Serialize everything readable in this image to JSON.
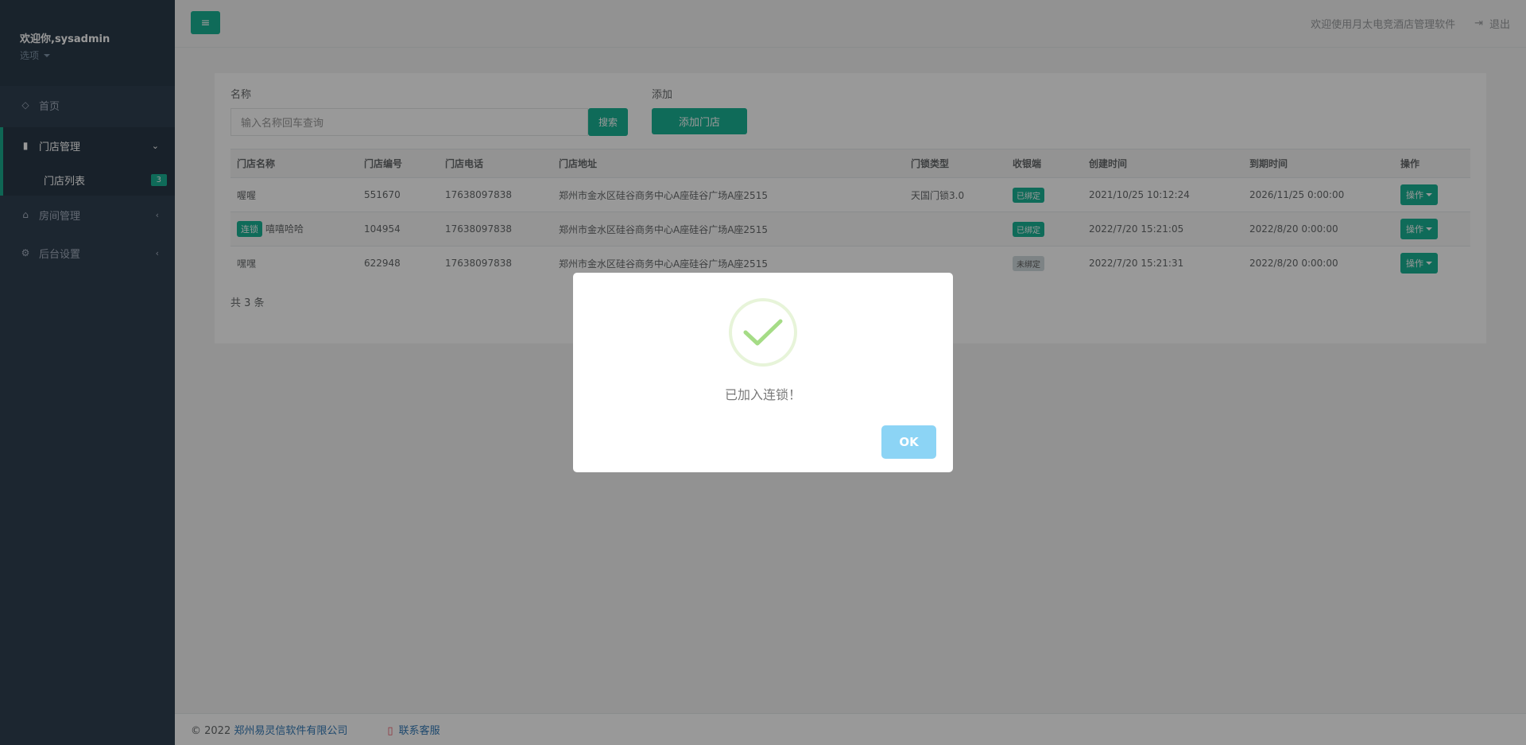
{
  "sidebar": {
    "welcome": "欢迎你,sysadmin",
    "options": "选项",
    "items": [
      {
        "label": "首页",
        "icon": "diamond-icon"
      },
      {
        "label": "门店管理",
        "icon": "building-icon"
      },
      {
        "label": "房间管理",
        "icon": "home-icon"
      },
      {
        "label": "后台设置",
        "icon": "gears-icon"
      }
    ],
    "sub_items": [
      {
        "label": "门店列表",
        "badge": "3"
      }
    ]
  },
  "header": {
    "welcome_text": "欢迎使用月太电竞酒店管理软件",
    "logout": "退出"
  },
  "search": {
    "label": "名称",
    "placeholder": "输入名称回车查询",
    "button": "搜索"
  },
  "add": {
    "label": "添加",
    "button": "添加门店"
  },
  "table": {
    "columns": [
      "门店名称",
      "门店编号",
      "门店电话",
      "门店地址",
      "门锁类型",
      "收银端",
      "创建时间",
      "到期时间",
      "操作"
    ],
    "rows": [
      {
        "tag": "",
        "name": "喔喔",
        "code": "551670",
        "phone": "17638097838",
        "address": "郑州市金水区硅谷商务中心A座硅谷广场A座2515",
        "lock": "天国门锁3.0",
        "cashier": "已绑定",
        "cashier_state": "bound",
        "created": "2021/10/25 10:12:24",
        "expires": "2026/11/25 0:00:00",
        "op": "操作"
      },
      {
        "tag": "连锁",
        "name": "嘻嘻哈哈",
        "code": "104954",
        "phone": "17638097838",
        "address": "郑州市金水区硅谷商务中心A座硅谷广场A座2515",
        "lock": "",
        "cashier": "已绑定",
        "cashier_state": "bound",
        "created": "2022/7/20 15:21:05",
        "expires": "2022/8/20 0:00:00",
        "op": "操作"
      },
      {
        "tag": "",
        "name": "嘿嘿",
        "code": "622948",
        "phone": "17638097838",
        "address": "郑州市金水区硅谷商务中心A座硅谷广场A座2515",
        "lock": "",
        "cashier": "未绑定",
        "cashier_state": "unbound",
        "created": "2022/7/20 15:21:31",
        "expires": "2022/8/20 0:00:00",
        "op": "操作"
      }
    ],
    "total": "共 3 条"
  },
  "footer": {
    "copyright": "© 2022",
    "company": "郑州易灵信软件有限公司",
    "contact": "联系客服"
  },
  "dialog": {
    "message": "已加入连锁！",
    "ok": "OK",
    "icon": "success-check-icon"
  },
  "colors": {
    "accent": "#1ab394",
    "sidebar": "#2f4050",
    "ok_button": "#8cd4f5",
    "check": "#a5dc86"
  }
}
